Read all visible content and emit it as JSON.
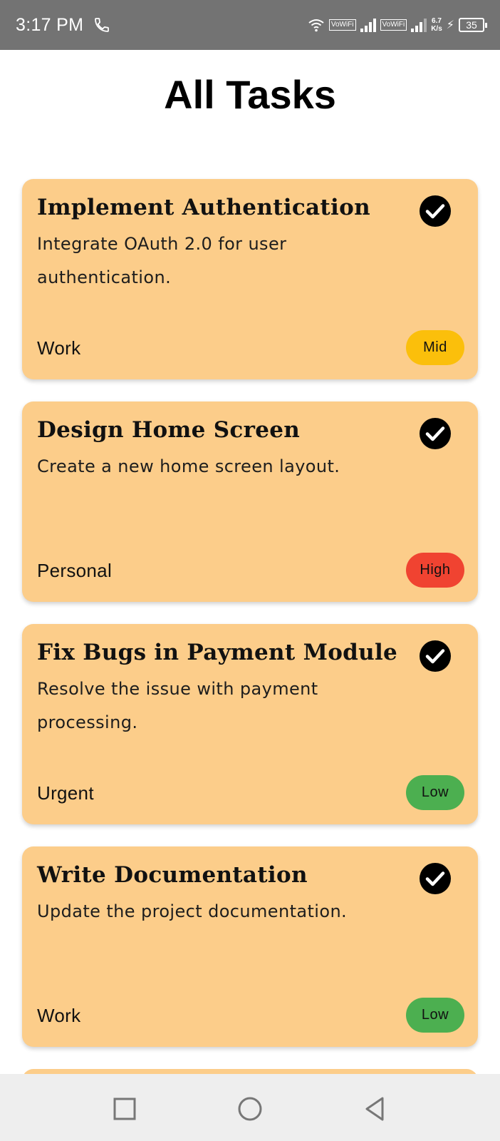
{
  "status_bar": {
    "time": "3:17 PM",
    "net_speed_value": "6.7",
    "net_speed_unit": "K/s",
    "vowifi_label": "VoWiFi",
    "battery": "35"
  },
  "page": {
    "title": "All Tasks"
  },
  "tasks": [
    {
      "title": "Implement Authentication",
      "description": "Integrate OAuth 2.0 for user authentication.",
      "category": "Work",
      "priority": "Mid",
      "priority_color": "#fbbf0b",
      "completed": true
    },
    {
      "title": "Design Home Screen",
      "description": "Create a new home screen layout.",
      "category": "Personal",
      "priority": "High",
      "priority_color": "#f04331",
      "completed": true
    },
    {
      "title": "Fix Bugs in Payment Module",
      "description": "Resolve the issue with payment processing.",
      "category": "Urgent",
      "priority": "Low",
      "priority_color": "#4caf50",
      "completed": true
    },
    {
      "title": "Write Documentation",
      "description": "Update the project documentation.",
      "category": "Work",
      "priority": "Low",
      "priority_color": "#4caf50",
      "completed": true
    }
  ],
  "colors": {
    "card_background": "#fccd8a",
    "status_bar": "#737373",
    "nav_bar": "#eeeeee"
  },
  "nav_bar": {
    "icons": [
      "recents-square-icon",
      "home-circle-icon",
      "back-triangle-icon"
    ]
  }
}
